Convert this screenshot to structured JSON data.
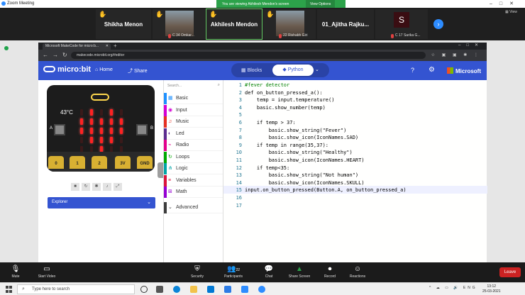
{
  "zoom": {
    "app_title": "Zoom Meeting",
    "viewing_banner": "You are viewing Akhilesh Mendon's screen",
    "view_options": "View Options",
    "view_label": "View",
    "participants": [
      {
        "name": "Shikha Menon",
        "sub": "",
        "hand": true
      },
      {
        "name": "",
        "sub": "C 34 Omkar...",
        "hand": true,
        "photo": true
      },
      {
        "name": "Akhilesh Mendon",
        "sub": "",
        "hand": true
      },
      {
        "name": "",
        "sub": "22 Rishabh Giri",
        "hand": true,
        "photo": true
      },
      {
        "name": "01_Ajitha Rajku...",
        "sub": "",
        "hand": false
      },
      {
        "name": "",
        "sub": "C 17 Sarika G...",
        "hand": false,
        "letter": "S"
      }
    ],
    "controls": [
      {
        "label": "Mute",
        "icon": "mic-icon"
      },
      {
        "label": "Start Video",
        "icon": "video-icon"
      },
      {
        "label": "Security",
        "icon": "shield-icon"
      },
      {
        "label": "Participants",
        "icon": "participants-icon",
        "count": "22"
      },
      {
        "label": "Chat",
        "icon": "chat-icon"
      },
      {
        "label": "Share Screen",
        "icon": "share-screen-icon"
      },
      {
        "label": "Record",
        "icon": "record-icon"
      },
      {
        "label": "Reactions",
        "icon": "reactions-icon"
      }
    ],
    "leave_label": "Leave"
  },
  "browser": {
    "tab_title": "Microsoft MakeCode for micro:b...",
    "url": "makecode.microbit.org/#editor"
  },
  "makecode": {
    "logo_text": "micro:bit",
    "home_label": "Home",
    "share_label": "Share",
    "blocks_label": "Blocks",
    "python_label": "Python",
    "brand_label": "Microsoft",
    "temperature_readout": "43°C",
    "pins": [
      "0",
      "1",
      "2",
      "3V",
      "GND"
    ],
    "explorer_label": "Explorer",
    "search_placeholder": "Search...",
    "categories": [
      {
        "label": "Basic",
        "color": "#1e90ff"
      },
      {
        "label": "Input",
        "color": "#d400d4"
      },
      {
        "label": "Music",
        "color": "#e63022"
      },
      {
        "label": "Led",
        "color": "#5c2d91"
      },
      {
        "label": "Radio",
        "color": "#e3008c"
      },
      {
        "label": "Loops",
        "color": "#00aa00"
      },
      {
        "label": "Logic",
        "color": "#00a4a6"
      },
      {
        "label": "Variables",
        "color": "#dc143c"
      },
      {
        "label": "Math",
        "color": "#9400d3"
      },
      {
        "label": "Advanced",
        "color": "#3c3c3c"
      }
    ],
    "led_pattern": [
      [
        0,
        1,
        0,
        1,
        0
      ],
      [
        1,
        1,
        1,
        1,
        1
      ],
      [
        1,
        1,
        1,
        1,
        1
      ],
      [
        0,
        1,
        1,
        1,
        0
      ],
      [
        0,
        0,
        1,
        0,
        0
      ]
    ],
    "code_lines": [
      "#fever detector",
      "def on_button_pressed_a():",
      "    temp = input.temperature()",
      "    basic.show_number(temp)",
      "",
      "    if temp > 37:",
      "        basic.show_string(\"Fever\")",
      "        basic.show_icon(IconNames.SAD)",
      "    if temp in range(35,37):",
      "        basic.show_string(\"Healthy\")",
      "        basic.show_icon(IconNames.HEART)",
      "    if temp<35:",
      "        basic.show_string(\"Not human\")",
      "        basic.show_icon(IconNames.SKULL)",
      "input.on_button_pressed(Button.A, on_button_pressed_a)",
      "",
      ""
    ],
    "highlighted_line": 15
  },
  "taskbar": {
    "search_placeholder": "Type here to search",
    "time": "13:12",
    "date": "25-03-2021",
    "lang": "ENG"
  }
}
